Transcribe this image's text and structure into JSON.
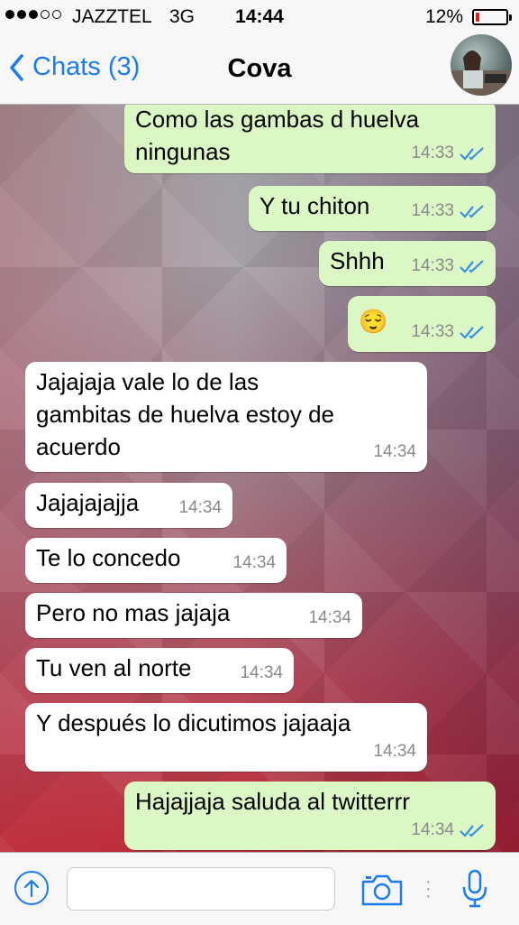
{
  "status_bar": {
    "carrier": "JAZZTEL",
    "network": "3G",
    "time": "14:44",
    "battery": "12%",
    "battery_level": 0.12
  },
  "nav": {
    "back_label": "Chats (3)",
    "title": "Cova"
  },
  "messages": [
    {
      "dir": "out",
      "text": "Como las gambas d huelva\nningunas",
      "time": "14:33",
      "read": true
    },
    {
      "dir": "out",
      "text": "Y tu chiton",
      "time": "14:33",
      "read": true
    },
    {
      "dir": "out",
      "text": "Shhh",
      "time": "14:33",
      "read": true
    },
    {
      "dir": "out",
      "text": "😌",
      "time": "14:33",
      "read": true
    },
    {
      "dir": "in",
      "text": "Jajajaja vale lo de las\ngambitas de huelva estoy de\nacuerdo",
      "time": "14:34"
    },
    {
      "dir": "in",
      "text": "Jajajajajja",
      "time": "14:34"
    },
    {
      "dir": "in",
      "text": "Te lo concedo",
      "time": "14:34"
    },
    {
      "dir": "in",
      "text": "Pero no mas jajaja",
      "time": "14:34"
    },
    {
      "dir": "in",
      "text": "Tu ven al norte",
      "time": "14:34"
    },
    {
      "dir": "in",
      "text": "Y después lo dicutimos jajaaja",
      "time": "14:34"
    },
    {
      "dir": "out",
      "text": "Hajajjaja saluda al twitterrr",
      "time": "14:34",
      "read": true
    }
  ],
  "input": {
    "placeholder": ""
  },
  "colors": {
    "accent": "#1a7cf5",
    "outgoing_bubble": "#dbf8c4",
    "incoming_bubble": "#ffffff",
    "battery_low": "#e01e1e"
  },
  "icons": {
    "back": "chevron-left-icon",
    "attach": "upload-arrow-icon",
    "camera": "camera-icon",
    "mic": "microphone-icon"
  }
}
